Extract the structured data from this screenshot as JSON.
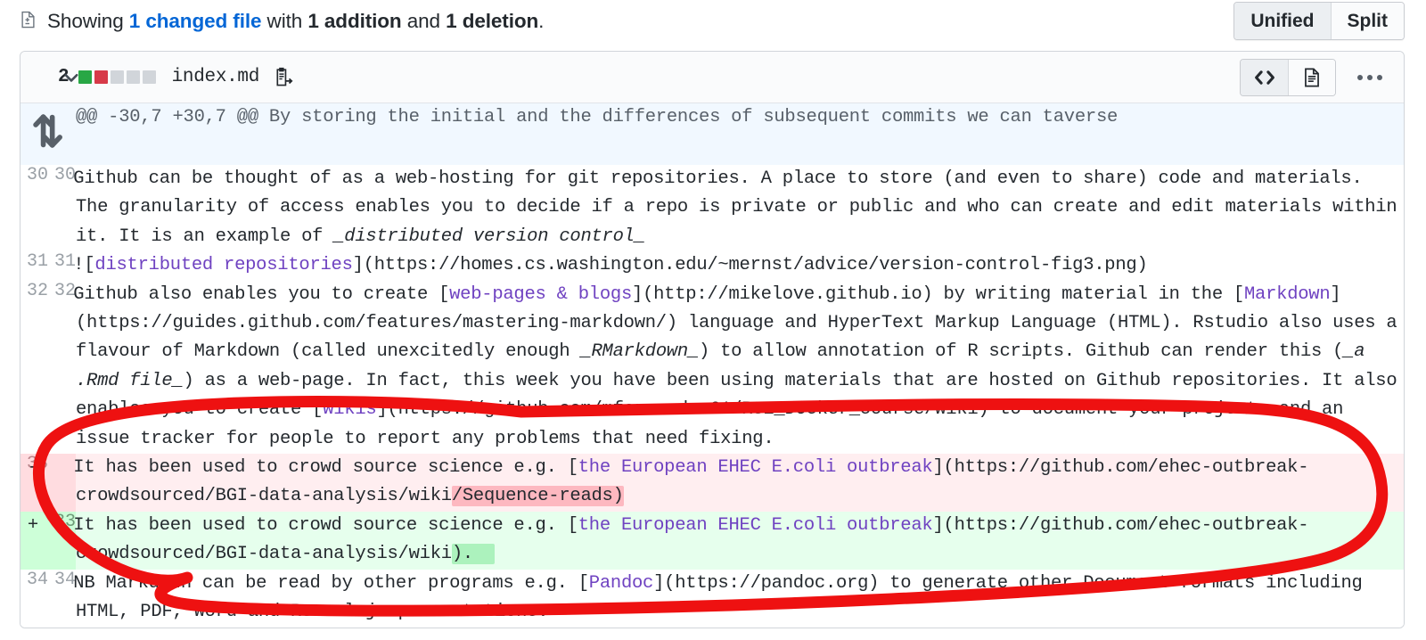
{
  "summary": {
    "icon": "file-diff-icon",
    "prefix": "Showing ",
    "changed_files_link": "1 changed file",
    "mid": " with ",
    "additions": "1 addition",
    "conj": " and ",
    "deletions": "1 deletion",
    "suffix": "."
  },
  "view_toggle": {
    "unified_label": "Unified",
    "split_label": "Split",
    "selected": "Unified"
  },
  "file": {
    "changes_count": "2",
    "filename": "index.md",
    "diffstat": {
      "added_blocks": 1,
      "deleted_blocks": 1,
      "neutral_blocks": 3,
      "added_color": "#28a745",
      "deleted_color": "#d73a49",
      "neutral_color": "#d1d5da"
    },
    "copy_path_icon": "copy-path-icon",
    "collapse_icon": "chevron-down-icon",
    "view_code_icon": "code-view-icon",
    "view_rendered_icon": "rendered-view-icon",
    "kebab_icon": "kebab-menu-icon",
    "selected_view": "code"
  },
  "hunk": {
    "expand_icon": "expand-up-down-icon",
    "header": "@@ -30,7 +30,7 @@ By storing the initial and the differences of subsequent commits we can taverse"
  },
  "diff_rows": [
    {
      "type": "context",
      "old_ln": "30",
      "new_ln": "30",
      "marker": " ",
      "segments": [
        {
          "t": "Github can be thought of as a web-hosting for git repositories. A place to store (and even to share) code and materials. The granularity of access enables you to decide if a repo is private or public and who can create and edit materials within it. It is an example of ",
          "c": "plain"
        },
        {
          "t": "_distributed version control_",
          "c": "md-em"
        }
      ]
    },
    {
      "type": "context",
      "old_ln": "31",
      "new_ln": "31",
      "marker": " ",
      "segments": [
        {
          "t": "![",
          "c": "plain"
        },
        {
          "t": "distributed repositories",
          "c": "md-link"
        },
        {
          "t": "](https://homes.cs.washington.edu/~mernst/advice/version-control-fig3.png)",
          "c": "plain"
        }
      ]
    },
    {
      "type": "context",
      "old_ln": "32",
      "new_ln": "32",
      "marker": " ",
      "segments": [
        {
          "t": "Github also enables you to create [",
          "c": "plain"
        },
        {
          "t": "web-pages & blogs",
          "c": "md-link"
        },
        {
          "t": "](http://mikelove.github.io) by writing material in the [",
          "c": "plain"
        },
        {
          "t": "Markdown",
          "c": "md-link"
        },
        {
          "t": "](https://guides.github.com/features/mastering-markdown/) language and HyperText Markup Language (HTML). Rstudio also uses a flavour of Markdown (called unexcitedly enough ",
          "c": "plain"
        },
        {
          "t": "_RMarkdown_",
          "c": "md-em"
        },
        {
          "t": ") to allow annotation of R scripts. Github can render this (",
          "c": "plain"
        },
        {
          "t": "_a .Rmd file_",
          "c": "md-em"
        },
        {
          "t": ") as a web-page. In fact, this week you have been using materials that are hosted on Github repositories. It also enables you to create [",
          "c": "plain"
        },
        {
          "t": "wikis",
          "c": "md-link"
        },
        {
          "t": "](https://github.com/mfernandes61/RSE_Docker_course/wiki) to document your projects and an issue tracker for people to report any problems that need fixing.",
          "c": "plain"
        }
      ]
    },
    {
      "type": "deletion",
      "old_ln": "33",
      "new_ln": "",
      "marker": "-",
      "segments": [
        {
          "t": "It has been used to crowd source science e.g. [",
          "c": "plain"
        },
        {
          "t": "the European EHEC E.coli outbreak",
          "c": "md-link"
        },
        {
          "t": "](https://github.com/ehec-outbreak-crowdsourced/BGI-data-analysis/wiki",
          "c": "plain"
        },
        {
          "t": "/Sequence-reads)",
          "c": "wd-del"
        }
      ]
    },
    {
      "type": "addition",
      "old_ln": "",
      "new_ln": "33",
      "marker": "+",
      "segments": [
        {
          "t": "It has been used to crowd source science e.g. [",
          "c": "plain"
        },
        {
          "t": "the European EHEC E.coli outbreak",
          "c": "md-link"
        },
        {
          "t": "](https://github.com/ehec-outbreak-crowdsourced/BGI-data-analysis/wiki",
          "c": "plain"
        },
        {
          "t": ").  ",
          "c": "wd-add"
        }
      ]
    },
    {
      "type": "context",
      "old_ln": "34",
      "new_ln": "34",
      "marker": " ",
      "segments": [
        {
          "t": "NB Markdown can be read by other programs e.g. [",
          "c": "plain"
        },
        {
          "t": "Pandoc",
          "c": "md-link"
        },
        {
          "t": "](https://pandoc.org) to generate other Document formats including HTML, PDF, Word and Reveal.js presentations.",
          "c": "plain"
        }
      ]
    }
  ],
  "annotation": {
    "shape": "hand-drawn-red-ellipse",
    "color": "#ee1111",
    "encircles": "deletion-and-addition-lines"
  }
}
